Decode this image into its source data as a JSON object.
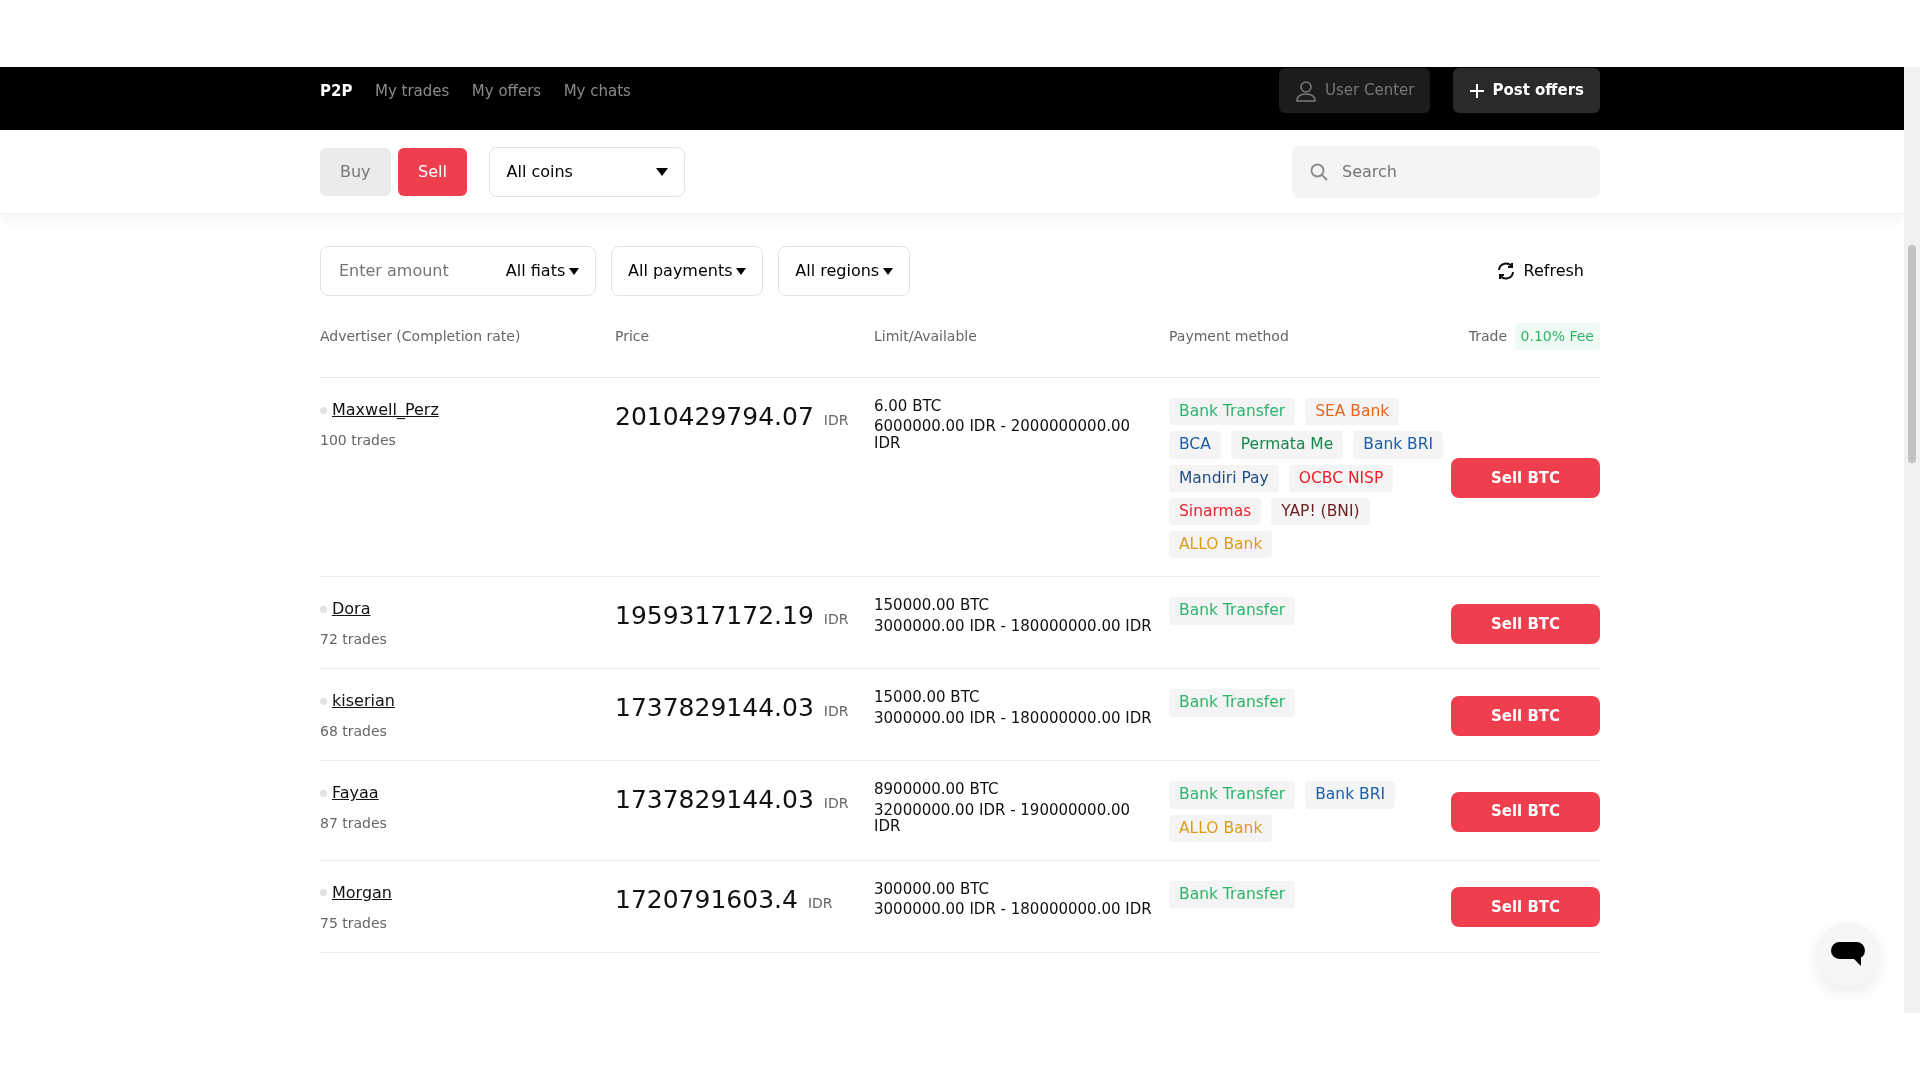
{
  "nav": {
    "tabs": [
      {
        "label": "P2P",
        "selected": true
      },
      {
        "label": "My trades",
        "selected": false
      },
      {
        "label": "My offers",
        "selected": false
      },
      {
        "label": "My chats",
        "selected": false
      }
    ],
    "user_center": "User Center",
    "post_offers": "Post offers"
  },
  "side_toggle": [
    {
      "label": "Buy",
      "selected": false
    },
    {
      "label": "Sell",
      "selected": true
    }
  ],
  "coin_select": "All coins",
  "search": {
    "placeholder": "Search"
  },
  "filters": {
    "amount_placeholder": "Enter amount",
    "fiats": "All fiats",
    "payments": "All payments",
    "regions": "All regions",
    "refresh": "Refresh"
  },
  "columns": {
    "advertiser": "Advertiser (Completion rate)",
    "price": "Price",
    "limit": "Limit/Available",
    "payment": "Payment method",
    "trade": "Trade",
    "fee": "0.10% Fee"
  },
  "rows": [
    {
      "name": "Maxwell_Perz",
      "trades": "100 trades",
      "price": "2010429794.07",
      "currency": "IDR",
      "available": "6.00 BTC",
      "limit": "6000000.00 IDR - 2000000000.00 IDR",
      "methods": [
        {
          "label": "Bank Transfer",
          "color": "#2fb36c"
        },
        {
          "label": "SEA Bank",
          "color": "#e5661f"
        },
        {
          "label": "BCA",
          "color": "#1b5faa"
        },
        {
          "label": "Permata Me",
          "color": "#17864a"
        },
        {
          "label": "Bank BRI",
          "color": "#1b5faa"
        },
        {
          "label": "Mandiri Pay",
          "color": "#1f4c86"
        },
        {
          "label": "OCBC NISP",
          "color": "#ee1c25"
        },
        {
          "label": "Sinarmas",
          "color": "#e3262f"
        },
        {
          "label": "YAP! (BNI)",
          "color": "#6e1c1c"
        },
        {
          "label": "ALLO Bank",
          "color": "#dc9c17"
        }
      ],
      "action": "Sell BTC"
    },
    {
      "name": "Dora",
      "trades": "72 trades",
      "price": "1959317172.19",
      "currency": "IDR",
      "available": "150000.00 BTC",
      "limit": "3000000.00 IDR - 180000000.00 IDR",
      "methods": [
        {
          "label": "Bank Transfer",
          "color": "#2fb36c"
        }
      ],
      "action": "Sell BTC"
    },
    {
      "name": "kiserian",
      "trades": "68 trades",
      "price": "1737829144.03",
      "currency": "IDR",
      "available": "15000.00 BTC",
      "limit": "3000000.00 IDR - 180000000.00 IDR",
      "methods": [
        {
          "label": "Bank Transfer",
          "color": "#2fb36c"
        }
      ],
      "action": "Sell BTC"
    },
    {
      "name": "Fayaa",
      "trades": "87 trades",
      "price": "1737829144.03",
      "currency": "IDR",
      "available": "8900000.00 BTC",
      "limit": "32000000.00 IDR - 190000000.00 IDR",
      "methods": [
        {
          "label": "Bank Transfer",
          "color": "#2fb36c"
        },
        {
          "label": "Bank BRI",
          "color": "#1b5faa"
        },
        {
          "label": "ALLO Bank",
          "color": "#dc9c17"
        }
      ],
      "action": "Sell BTC"
    },
    {
      "name": "Morgan",
      "trades": "75 trades",
      "price": "1720791603.4",
      "currency": "IDR",
      "available": "300000.00 BTC",
      "limit": "3000000.00 IDR - 180000000.00 IDR",
      "methods": [
        {
          "label": "Bank Transfer",
          "color": "#2fb36c"
        }
      ],
      "action": "Sell BTC"
    }
  ]
}
